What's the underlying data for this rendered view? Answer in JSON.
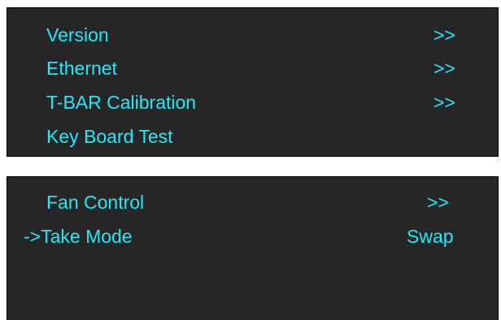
{
  "colors": {
    "text": "#27e6f5",
    "panel_bg": "#262626",
    "page_bg": "#ffffff"
  },
  "menu_top": {
    "items": [
      {
        "label": "Version",
        "value": ">>"
      },
      {
        "label": "Ethernet",
        "value": ">>"
      },
      {
        "label": "T-BAR Calibration",
        "value": ">>"
      },
      {
        "label": "Key Board Test",
        "value": ""
      }
    ]
  },
  "menu_bottom": {
    "items": [
      {
        "label": "Fan Control",
        "value": ">>"
      },
      {
        "label": "->Take Mode",
        "value": "Swap"
      }
    ]
  }
}
